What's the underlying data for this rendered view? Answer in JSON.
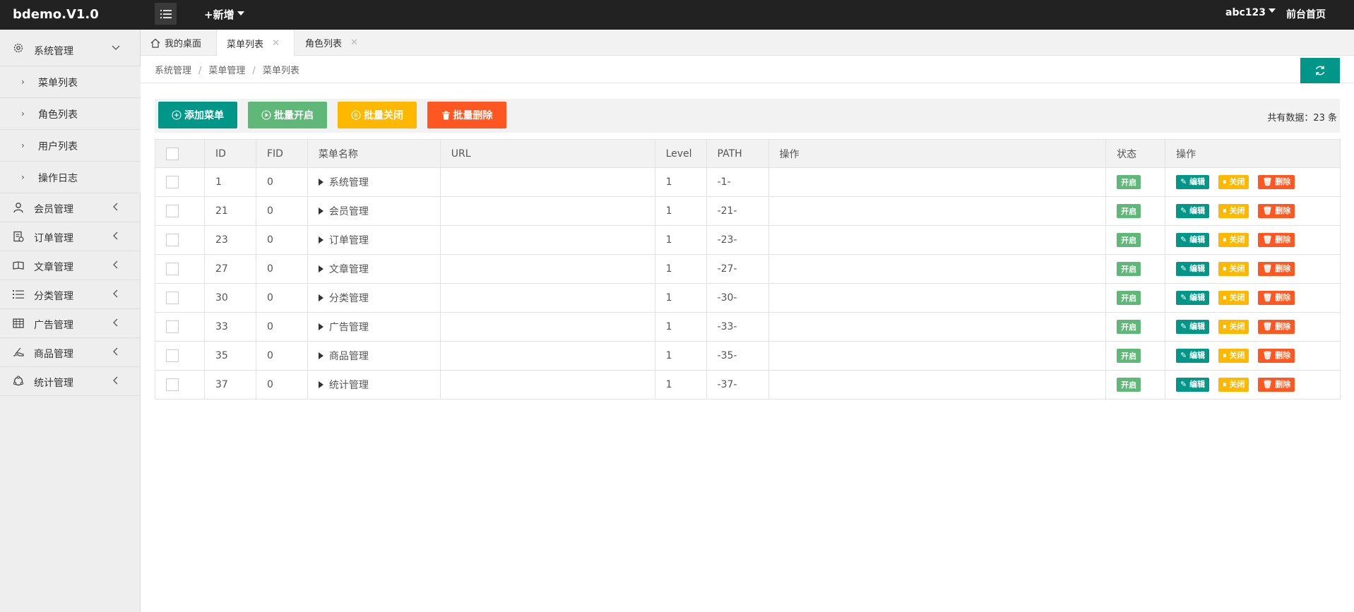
{
  "app": {
    "logo": "bdemo.V1.0",
    "add_new": "+新增",
    "user": "abc123",
    "homepage": "前台首页"
  },
  "sidebar": {
    "system": {
      "label": "系统管理"
    },
    "children": [
      {
        "label": "菜单列表"
      },
      {
        "label": "角色列表"
      },
      {
        "label": "用户列表"
      },
      {
        "label": "操作日志"
      }
    ],
    "groups": [
      {
        "label": "会员管理",
        "icon": "user-icon"
      },
      {
        "label": "订单管理",
        "icon": "order-icon"
      },
      {
        "label": "文章管理",
        "icon": "book-icon"
      },
      {
        "label": "分类管理",
        "icon": "list-icon"
      },
      {
        "label": "广告管理",
        "icon": "ad-icon"
      },
      {
        "label": "商品管理",
        "icon": "shoe-icon"
      },
      {
        "label": "统计管理",
        "icon": "chart-icon"
      }
    ]
  },
  "tabs": [
    {
      "label": "我的桌面"
    },
    {
      "label": "菜单列表"
    },
    {
      "label": "角色列表"
    }
  ],
  "breadcrumb": [
    "系统管理",
    "菜单管理",
    "菜单列表"
  ],
  "toolbar": {
    "add": "添加菜单",
    "open": "批量开启",
    "close": "批量关闭",
    "delete": "批量删除",
    "count": "共有数据：23 条"
  },
  "table": {
    "headers": {
      "id": "ID",
      "fid": "FID",
      "name": "菜单名称",
      "url": "URL",
      "level": "Level",
      "path": "PATH",
      "op1": "操作",
      "status": "状态",
      "op2": "操作"
    },
    "rows": [
      {
        "id": "1",
        "fid": "0",
        "name": "系统管理",
        "url": "",
        "level": "1",
        "path": "-1-",
        "status": "开启"
      },
      {
        "id": "21",
        "fid": "0",
        "name": "会员管理",
        "url": "",
        "level": "1",
        "path": "-21-",
        "status": "开启"
      },
      {
        "id": "23",
        "fid": "0",
        "name": "订单管理",
        "url": "",
        "level": "1",
        "path": "-23-",
        "status": "开启"
      },
      {
        "id": "27",
        "fid": "0",
        "name": "文章管理",
        "url": "",
        "level": "1",
        "path": "-27-",
        "status": "开启"
      },
      {
        "id": "30",
        "fid": "0",
        "name": "分类管理",
        "url": "",
        "level": "1",
        "path": "-30-",
        "status": "开启"
      },
      {
        "id": "33",
        "fid": "0",
        "name": "广告管理",
        "url": "",
        "level": "1",
        "path": "-33-",
        "status": "开启"
      },
      {
        "id": "35",
        "fid": "0",
        "name": "商品管理",
        "url": "",
        "level": "1",
        "path": "-35-",
        "status": "开启"
      },
      {
        "id": "37",
        "fid": "0",
        "name": "统计管理",
        "url": "",
        "level": "1",
        "path": "-37-",
        "status": "开启"
      }
    ],
    "actions": {
      "edit": "编辑",
      "close": "关闭",
      "delete": "删除"
    }
  },
  "colors": {
    "primary": "#009688",
    "green": "#5fb878",
    "warn": "#ffb800",
    "danger": "#ff5722",
    "topbar": "#222222"
  }
}
